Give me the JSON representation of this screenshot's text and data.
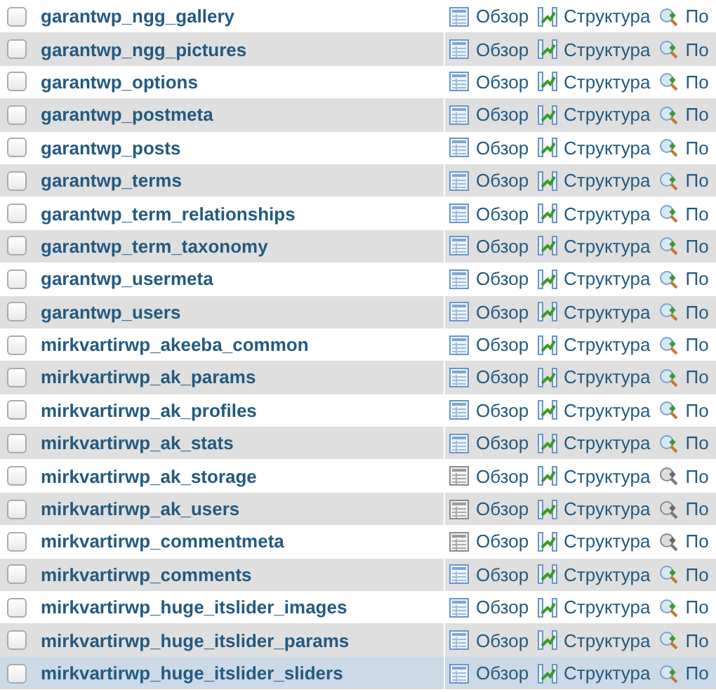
{
  "tables": [
    {
      "name": "garantwp_ngg_gallery",
      "checked": false,
      "empty": false,
      "hover": false,
      "browse": "Обзор",
      "structure": "Структура",
      "search": "По"
    },
    {
      "name": "garantwp_ngg_pictures",
      "checked": false,
      "empty": false,
      "hover": false,
      "browse": "Обзор",
      "structure": "Структура",
      "search": "По"
    },
    {
      "name": "garantwp_options",
      "checked": false,
      "empty": false,
      "hover": false,
      "browse": "Обзор",
      "structure": "Структура",
      "search": "По"
    },
    {
      "name": "garantwp_postmeta",
      "checked": false,
      "empty": false,
      "hover": false,
      "browse": "Обзор",
      "structure": "Структура",
      "search": "По"
    },
    {
      "name": "garantwp_posts",
      "checked": false,
      "empty": false,
      "hover": false,
      "browse": "Обзор",
      "structure": "Структура",
      "search": "По"
    },
    {
      "name": "garantwp_terms",
      "checked": false,
      "empty": false,
      "hover": false,
      "browse": "Обзор",
      "structure": "Структура",
      "search": "По"
    },
    {
      "name": "garantwp_term_relationships",
      "checked": false,
      "empty": false,
      "hover": false,
      "browse": "Обзор",
      "structure": "Структура",
      "search": "По"
    },
    {
      "name": "garantwp_term_taxonomy",
      "checked": false,
      "empty": false,
      "hover": false,
      "browse": "Обзор",
      "structure": "Структура",
      "search": "По"
    },
    {
      "name": "garantwp_usermeta",
      "checked": false,
      "empty": false,
      "hover": false,
      "browse": "Обзор",
      "structure": "Структура",
      "search": "По"
    },
    {
      "name": "garantwp_users",
      "checked": false,
      "empty": false,
      "hover": false,
      "browse": "Обзор",
      "structure": "Структура",
      "search": "По"
    },
    {
      "name": "mirkvartirwp_akeeba_common",
      "checked": false,
      "empty": false,
      "hover": false,
      "browse": "Обзор",
      "structure": "Структура",
      "search": "По"
    },
    {
      "name": "mirkvartirwp_ak_params",
      "checked": false,
      "empty": false,
      "hover": false,
      "browse": "Обзор",
      "structure": "Структура",
      "search": "По"
    },
    {
      "name": "mirkvartirwp_ak_profiles",
      "checked": false,
      "empty": false,
      "hover": false,
      "browse": "Обзор",
      "structure": "Структура",
      "search": "По"
    },
    {
      "name": "mirkvartirwp_ak_stats",
      "checked": false,
      "empty": false,
      "hover": false,
      "browse": "Обзор",
      "structure": "Структура",
      "search": "По"
    },
    {
      "name": "mirkvartirwp_ak_storage",
      "checked": false,
      "empty": true,
      "hover": false,
      "browse": "Обзор",
      "structure": "Структура",
      "search": "По"
    },
    {
      "name": "mirkvartirwp_ak_users",
      "checked": false,
      "empty": true,
      "hover": false,
      "browse": "Обзор",
      "structure": "Структура",
      "search": "По"
    },
    {
      "name": "mirkvartirwp_commentmeta",
      "checked": false,
      "empty": true,
      "hover": false,
      "browse": "Обзор",
      "structure": "Структура",
      "search": "По"
    },
    {
      "name": "mirkvartirwp_comments",
      "checked": false,
      "empty": false,
      "hover": false,
      "browse": "Обзор",
      "structure": "Структура",
      "search": "По"
    },
    {
      "name": "mirkvartirwp_huge_itslider_images",
      "checked": false,
      "empty": false,
      "hover": false,
      "browse": "Обзор",
      "structure": "Структура",
      "search": "По"
    },
    {
      "name": "mirkvartirwp_huge_itslider_params",
      "checked": false,
      "empty": false,
      "hover": false,
      "browse": "Обзор",
      "structure": "Структура",
      "search": "По"
    },
    {
      "name": "mirkvartirwp_huge_itslider_sliders",
      "checked": false,
      "empty": false,
      "hover": true,
      "browse": "Обзор",
      "structure": "Структура",
      "search": "По"
    }
  ]
}
